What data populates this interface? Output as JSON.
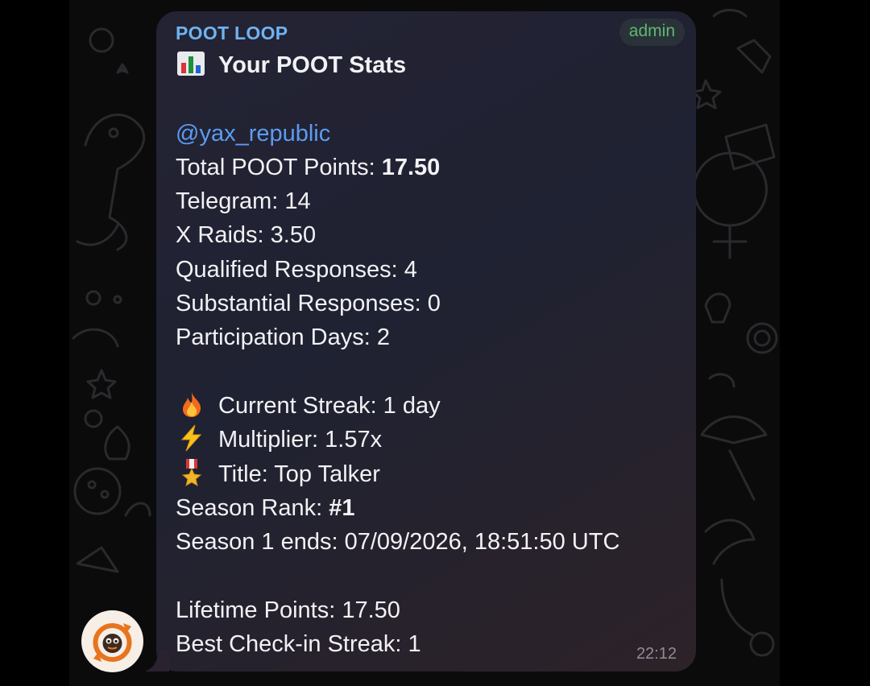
{
  "message": {
    "sender": "POOT LOOP",
    "badge": "admin",
    "title": "Your POOT Stats",
    "title_icon": "bar-chart-icon",
    "mention": "@yax_republic",
    "stats": [
      {
        "label": "Total POOT Points: ",
        "value": "17.50"
      },
      {
        "label": "Telegram: ",
        "value": "14"
      },
      {
        "label": "X Raids: ",
        "value": "3.50"
      },
      {
        "label": "Qualified Responses: ",
        "value": "4"
      },
      {
        "label": "Substantial Responses: ",
        "value": "0"
      },
      {
        "label": "Participation Days: ",
        "value": "2"
      }
    ],
    "extras": [
      {
        "icon": "fire-icon",
        "text": "Current Streak: 1 day"
      },
      {
        "icon": "lightning-icon",
        "text": "Multiplier: 1.57x"
      },
      {
        "icon": "medal-icon",
        "text": "Title: Top Talker"
      }
    ],
    "season_rank": {
      "label": "Season Rank: ",
      "value": "#1"
    },
    "season_end": "Season 1 ends: 07/09/2026, 18:51:50 UTC",
    "lifetime": [
      "Lifetime Points: 17.50",
      "Best Check-in Streak: 1"
    ],
    "time": "22:12"
  },
  "colors": {
    "sender": "#6fb3f2",
    "mention": "#5b9cf0",
    "badge": "#5fb870",
    "text": "#f2f2f4",
    "time": "#8f8d98"
  },
  "avatar_icon": "poot-loop-logo-icon"
}
